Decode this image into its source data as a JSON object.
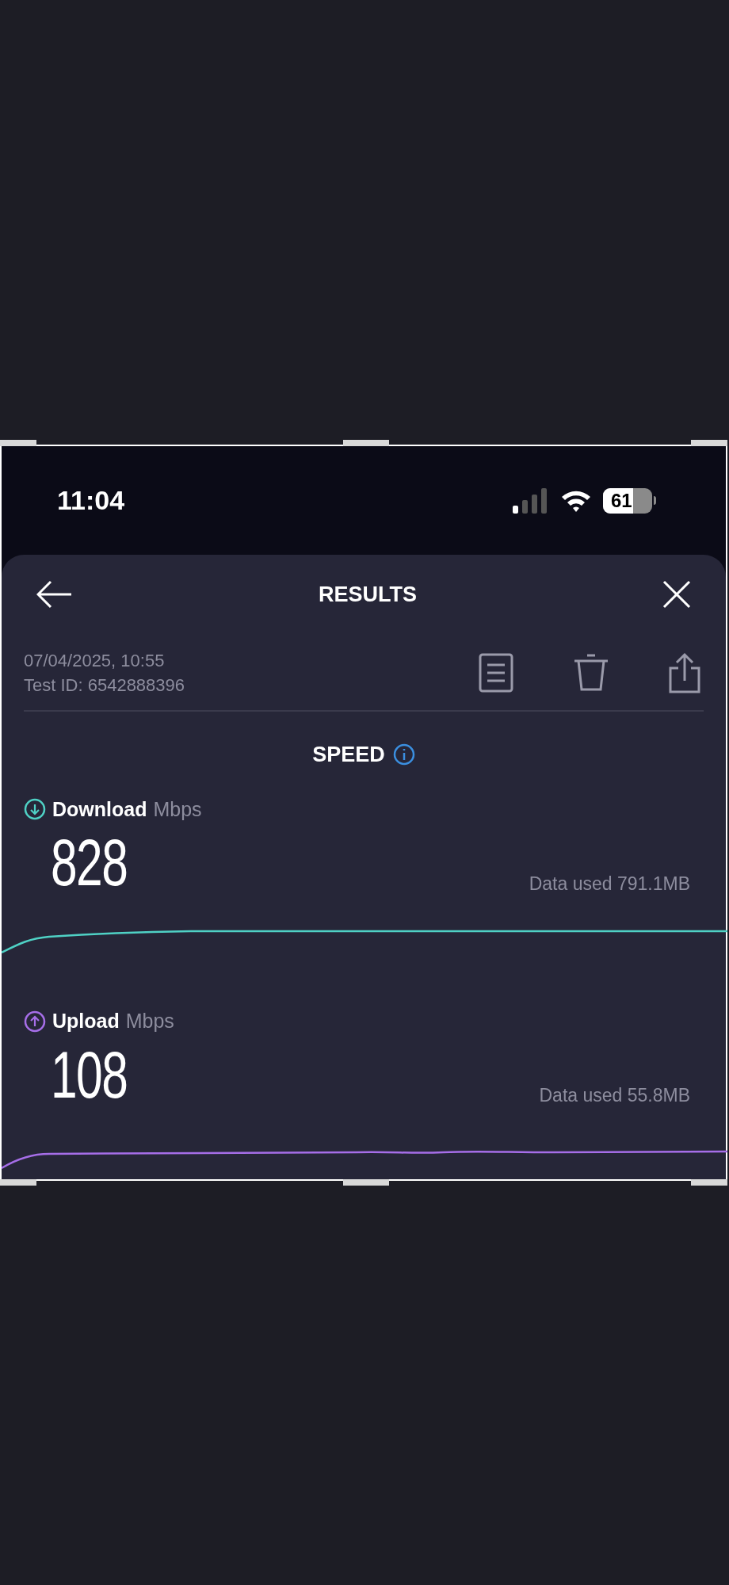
{
  "status_bar": {
    "time": "11:04",
    "battery": "61"
  },
  "header": {
    "title": "RESULTS"
  },
  "test": {
    "date": "07/04/2025, 10:55",
    "test_id": "Test ID: 6542888396"
  },
  "section": {
    "title": "SPEED"
  },
  "metrics": [
    {
      "kind": "download",
      "label": "Download",
      "unit": "Mbps",
      "value": "828",
      "data_used": "Data used 791.1MB",
      "color": "#4fd1c5"
    },
    {
      "kind": "upload",
      "label": "Upload",
      "unit": "Mbps",
      "value": "108",
      "data_used": "Data used 55.8MB",
      "color": "#a66ee8"
    }
  ]
}
